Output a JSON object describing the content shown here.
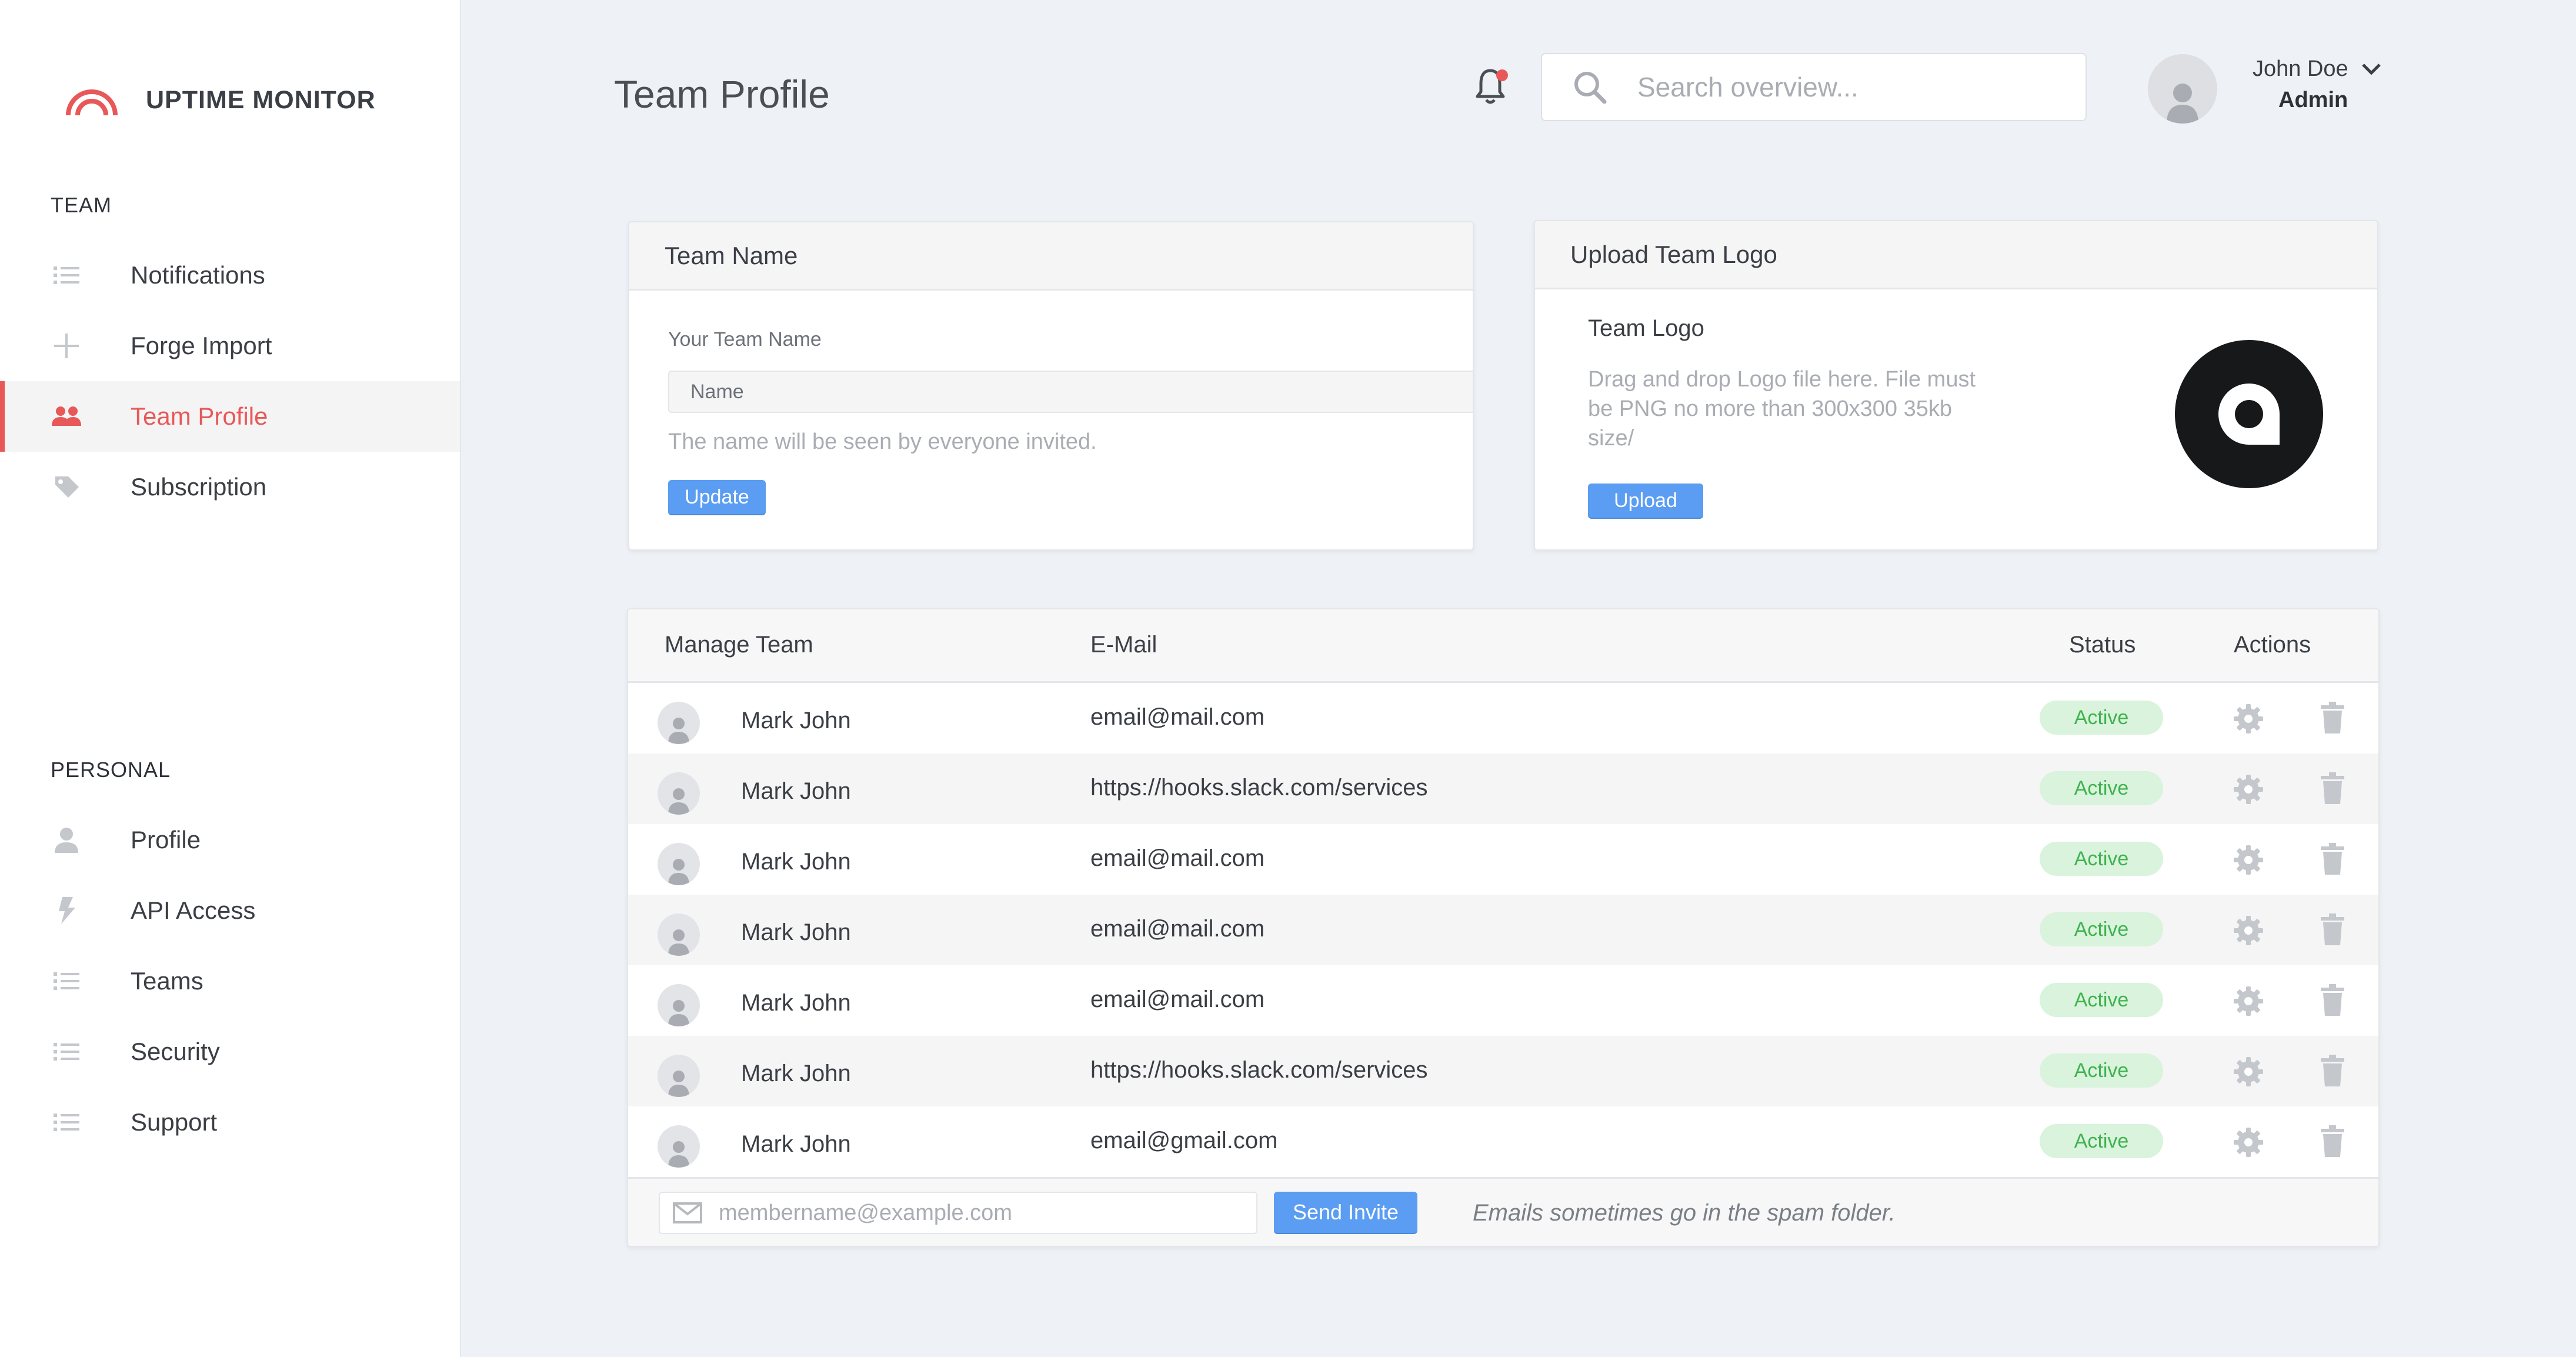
{
  "app": {
    "name": "UPTIME MONITOR"
  },
  "colors": {
    "accent": "#e85858",
    "primary": "#5a9df2",
    "active_bg": "#d9f3dc",
    "active_text": "#3fb24f"
  },
  "sidebar": {
    "team_section": "TEAM",
    "team_items": [
      {
        "label": "Notifications",
        "icon": "list-icon"
      },
      {
        "label": "Forge Import",
        "icon": "plus-icon"
      },
      {
        "label": "Team Profile",
        "icon": "users-icon",
        "active": true
      },
      {
        "label": "Subscription",
        "icon": "tag-icon"
      }
    ],
    "personal_section": "PERSONAL",
    "personal_items": [
      {
        "label": "Profile",
        "icon": "user-icon"
      },
      {
        "label": "API Access",
        "icon": "bolt-icon"
      },
      {
        "label": "Teams",
        "icon": "list-icon"
      },
      {
        "label": "Security",
        "icon": "list-icon"
      },
      {
        "label": "Support",
        "icon": "list-icon"
      }
    ]
  },
  "header": {
    "title": "Team Profile",
    "search_placeholder": "Search overview...",
    "user_name": "John Doe",
    "user_role": "Admin"
  },
  "team_name_card": {
    "title": "Team Name",
    "field_label": "Your Team Name",
    "field_placeholder": "Name",
    "hint": "The name will be seen by everyone invited.",
    "button": "Update"
  },
  "logo_card": {
    "title": "Upload Team Logo",
    "subtitle": "Team Logo",
    "hint_lines": [
      "Drag and drop Logo file here. File must",
      "be PNG no more than 300x300 35kb",
      "size/"
    ],
    "button": "Upload"
  },
  "manage_team": {
    "columns": {
      "member": "Manage Team",
      "email": "E-Mail",
      "status": "Status",
      "actions": "Actions"
    },
    "rows": [
      {
        "name": "Mark John",
        "email": "email@mail.com",
        "status": "Active"
      },
      {
        "name": "Mark John",
        "email": "https://hooks.slack.com/services",
        "status": "Active"
      },
      {
        "name": "Mark John",
        "email": "email@mail.com",
        "status": "Active"
      },
      {
        "name": "Mark John",
        "email": "email@mail.com",
        "status": "Active"
      },
      {
        "name": "Mark John",
        "email": "email@mail.com",
        "status": "Active"
      },
      {
        "name": "Mark John",
        "email": "https://hooks.slack.com/services",
        "status": "Active"
      },
      {
        "name": "Mark John",
        "email": "email@gmail.com",
        "status": "Active"
      }
    ],
    "invite_placeholder": "membername@example.com",
    "invite_button": "Send Invite",
    "note": "Emails sometimes go in the spam folder."
  }
}
